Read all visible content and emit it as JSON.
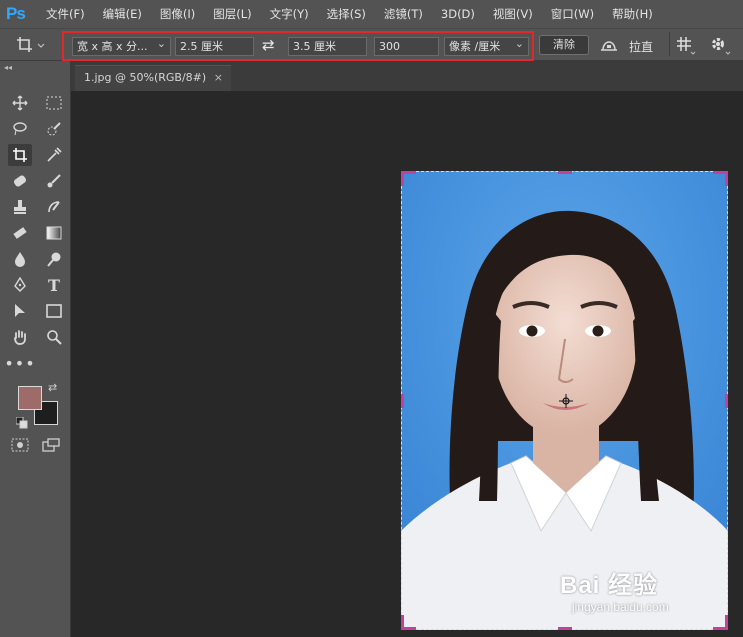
{
  "app": {
    "logo": "Ps"
  },
  "menu": [
    "文件(F)",
    "编辑(E)",
    "图像(I)",
    "图层(L)",
    "文字(Y)",
    "选择(S)",
    "滤镜(T)",
    "3D(D)",
    "视图(V)",
    "窗口(W)",
    "帮助(H)"
  ],
  "options": {
    "ratio_preset": "宽 x 高 x 分...",
    "width_value": "2.5 厘米",
    "height_value": "3.5 厘米",
    "resolution_value": "300",
    "resolution_unit": "像素 /厘米",
    "clear_label": "清除",
    "straighten_label": "拉直",
    "swap_icon": "⇄",
    "crop_icon": "crop-icon"
  },
  "document": {
    "tab_title": "1.jpg @ 50%(RGB/8#)",
    "close_symbol": "×"
  },
  "colors": {
    "foreground": "#9e6b6b",
    "background": "#1e1e1e",
    "highlight": "#e0292b",
    "photo_bg": "#4390dc"
  },
  "watermark": {
    "main": "Bai 经验",
    "sub": "jingyan.baidu.com"
  }
}
